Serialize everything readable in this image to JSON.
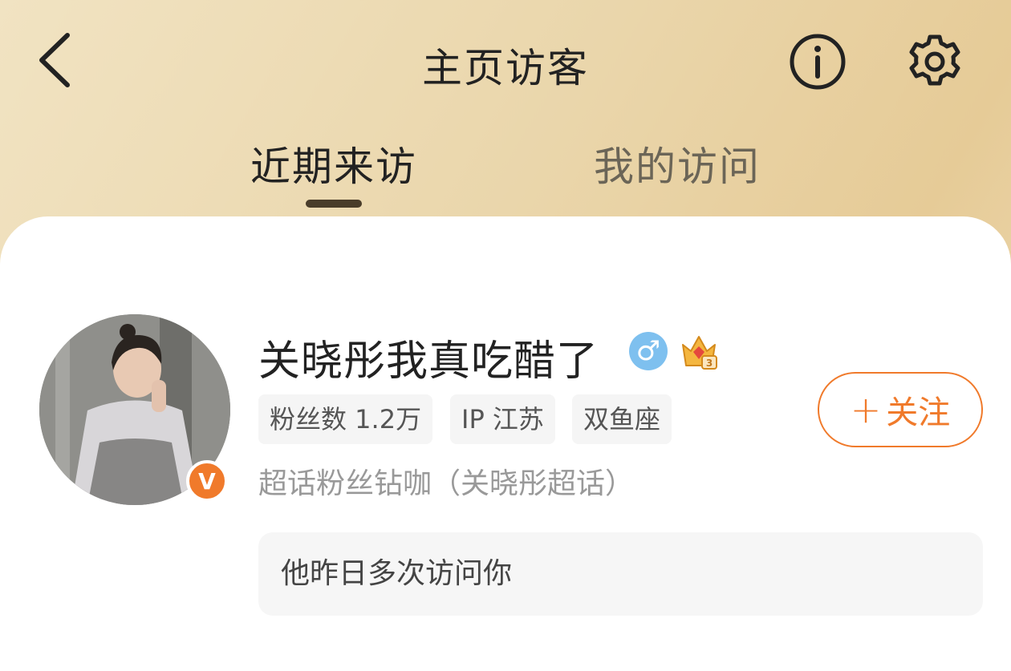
{
  "header": {
    "title": "主页访客",
    "back_icon": "chevron-left-icon",
    "info_icon": "info-icon",
    "settings_icon": "gear-icon"
  },
  "tabs": [
    {
      "label": "近期来访",
      "active": true
    },
    {
      "label": "我的访问",
      "active": false
    }
  ],
  "visitor": {
    "name": "关晓彤我真吃醋了",
    "gender_symbol": "♂",
    "verified_mark": "V",
    "tags": [
      "粉丝数 1.2万",
      "IP 江苏",
      "双鱼座"
    ],
    "supertopic": "超话粉丝钻咖（关晓彤超话）",
    "follow_label": "关注",
    "follow_plus": "+",
    "visit_note": "他昨日多次访问你"
  },
  "colors": {
    "accent": "#f07a2b",
    "gender_badge": "#7ec0ef",
    "tab_indicator": "#4a3d2a"
  }
}
